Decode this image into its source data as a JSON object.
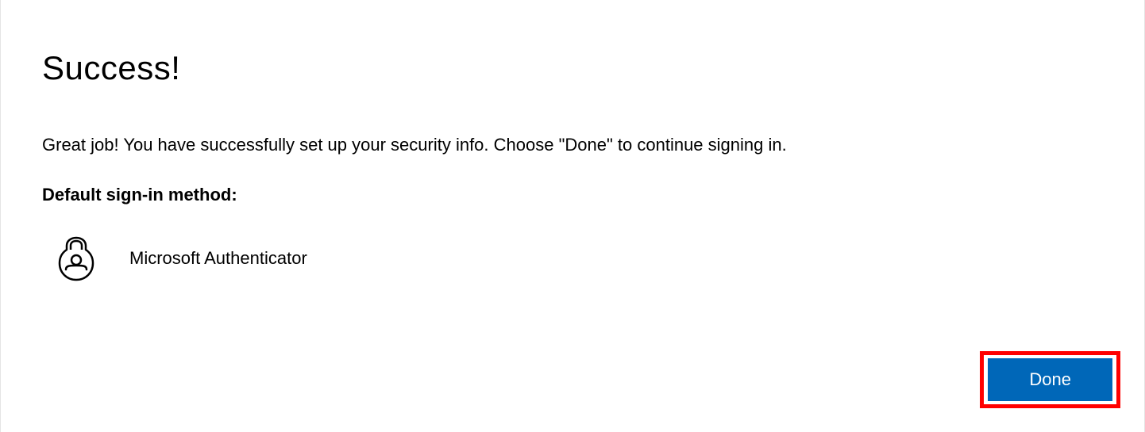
{
  "title": "Success!",
  "description": "Great job! You have successfully set up your security info. Choose \"Done\" to continue signing in.",
  "method_label": "Default sign-in method:",
  "method_name": "Microsoft Authenticator",
  "done_label": "Done"
}
